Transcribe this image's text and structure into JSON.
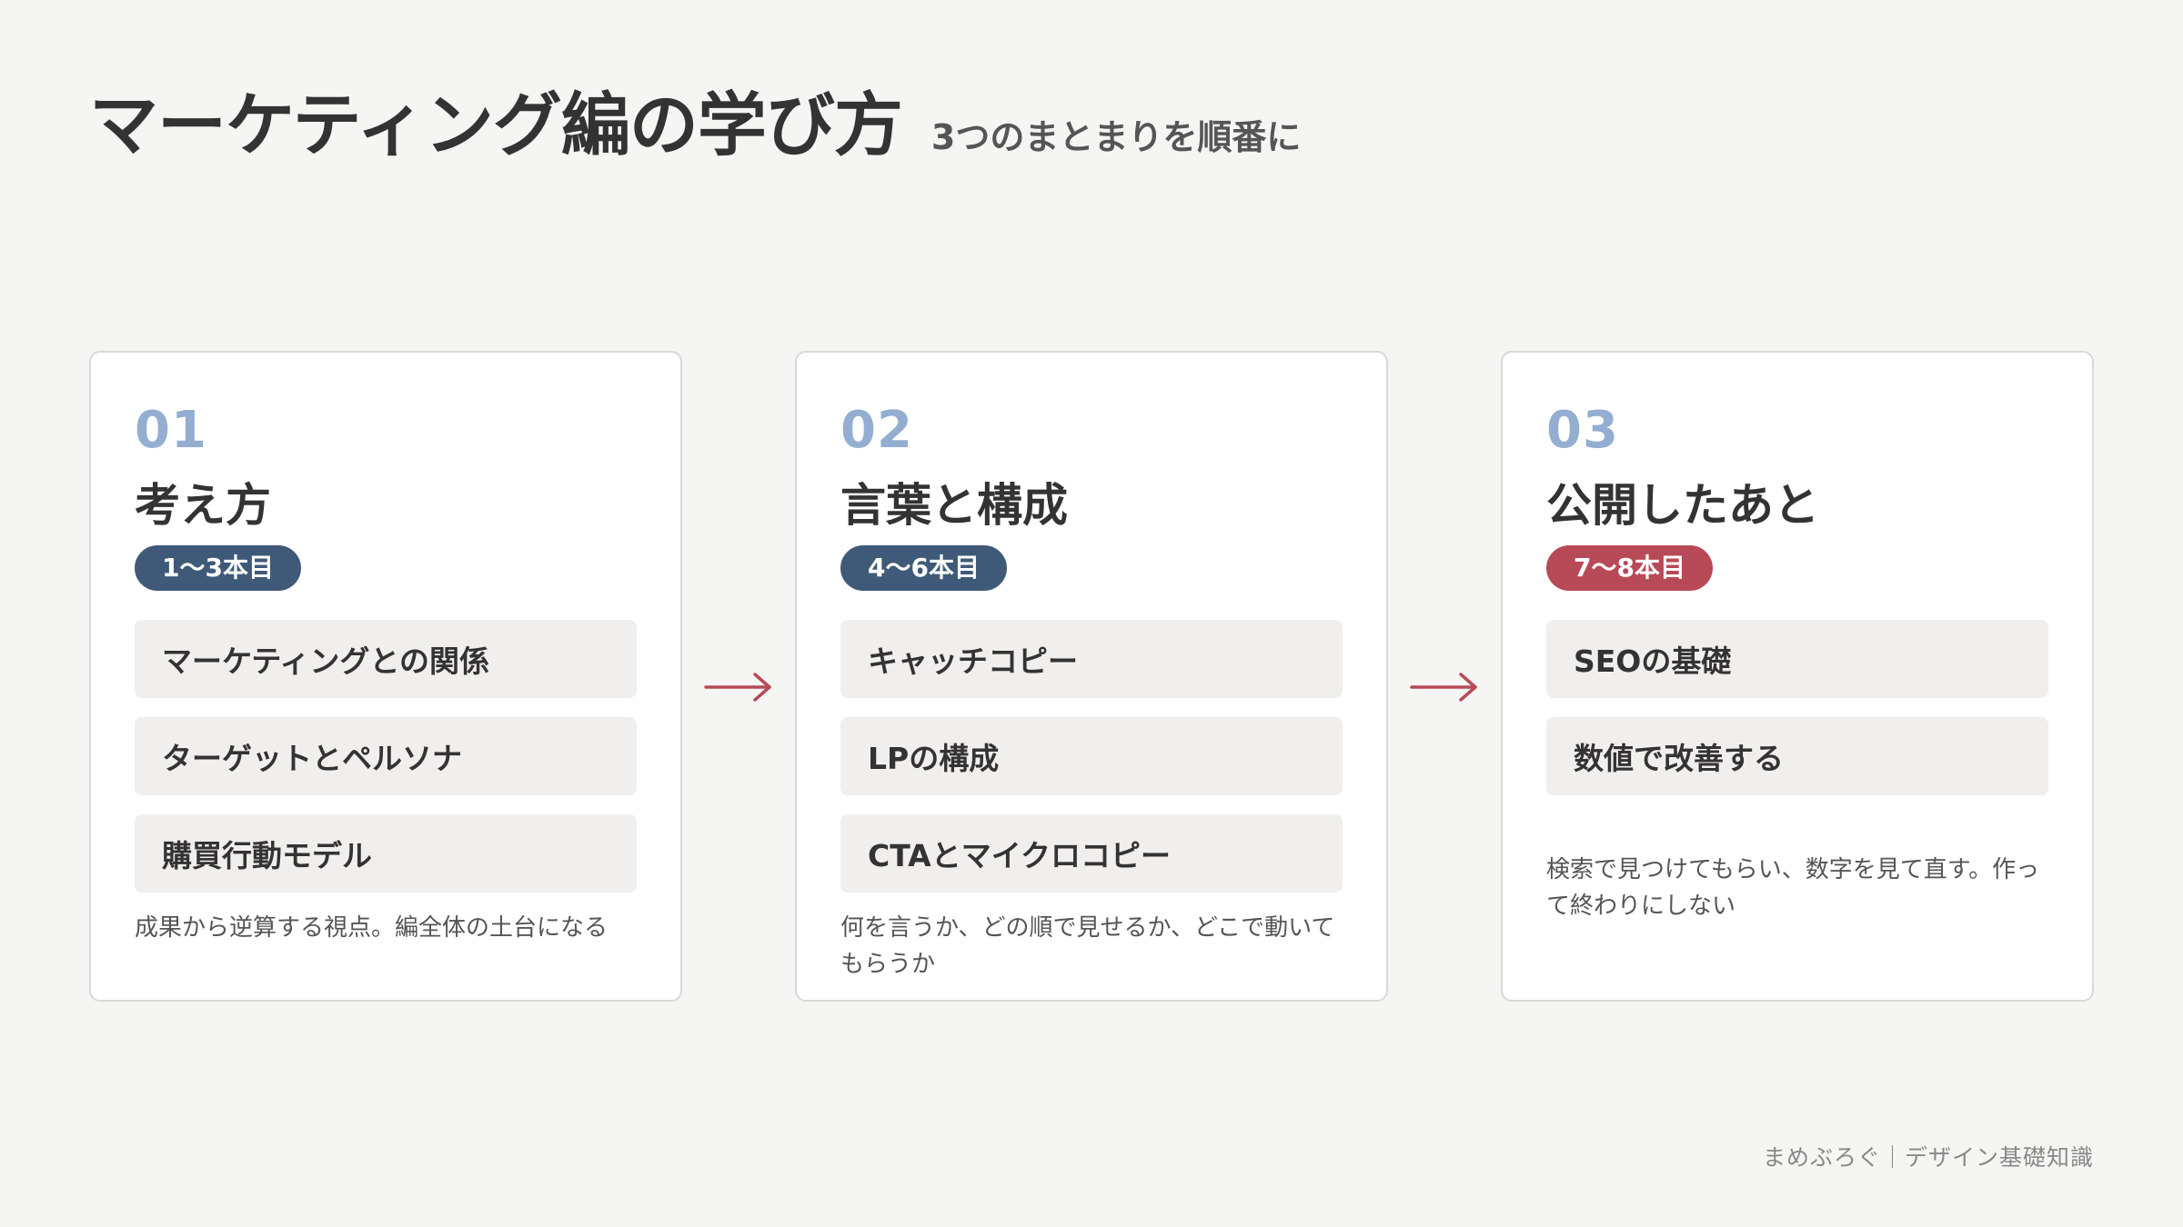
{
  "header": {
    "title": "マーケティング編の学び方",
    "subtitle": "3つのまとまりを順番に"
  },
  "colors": {
    "background": "#f5f5f3",
    "number": "#93aed0",
    "pill_navy": "#3f5a78",
    "pill_red": "#b84a58",
    "arrow": "#b84a58"
  },
  "steps": [
    {
      "number": "01",
      "title": "考え方",
      "badge": "1〜3本目",
      "badge_color": "#3f5a78",
      "items": [
        "マーケティングとの関係",
        "ターゲットとペルソナ",
        "購買行動モデル"
      ],
      "description": "成果から逆算する視点。編全体の土台になる"
    },
    {
      "number": "02",
      "title": "言葉と構成",
      "badge": "4〜6本目",
      "badge_color": "#3f5a78",
      "items": [
        "キャッチコピー",
        "LPの構成",
        "CTAとマイクロコピー"
      ],
      "description": "何を言うか、どの順で見せるか、どこで動いてもらうか"
    },
    {
      "number": "03",
      "title": "公開したあと",
      "badge": "7〜8本目",
      "badge_color": "#b84a58",
      "items": [
        "SEOの基礎",
        "数値で改善する"
      ],
      "description": "検索で見つけてもらい、数字を見て直す。作って終わりにしない"
    }
  ],
  "arrows": [
    {
      "icon": "right-arrow-icon"
    },
    {
      "icon": "right-arrow-icon"
    }
  ],
  "footer": {
    "credit": "まめぶろぐ｜デザイン基礎知識"
  }
}
